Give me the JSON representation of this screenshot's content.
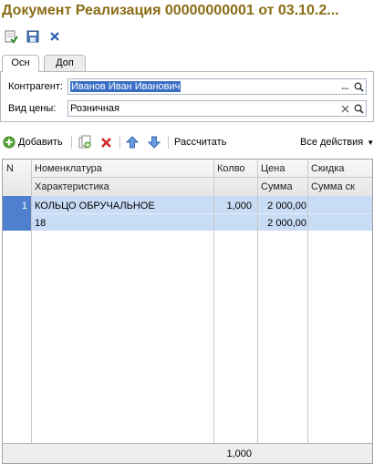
{
  "window": {
    "title": "Документ Реализация 00000000001 от 03.10.2..."
  },
  "toolbar": {
    "items": [
      {
        "name": "post-and-close",
        "icon": "post-and-close-icon"
      },
      {
        "name": "save",
        "icon": "save-icon"
      },
      {
        "name": "close",
        "icon": "close-icon"
      }
    ]
  },
  "tabs": [
    {
      "label": "Осн",
      "active": true
    },
    {
      "label": "Доп",
      "active": false
    }
  ],
  "form": {
    "counterparty_label": "Контрагент:",
    "counterparty_value": "Иванов Иван Иванович",
    "counterparty_buttons": [
      "...",
      "search-icon"
    ],
    "price_type_label": "Вид цены:",
    "price_type_value": "Розничная",
    "price_type_buttons": [
      "clear-icon",
      "search-icon"
    ]
  },
  "command_bar": {
    "add_label": "Добавить",
    "recalculate_label": "Рассчитать",
    "all_actions_label": "Все действия"
  },
  "table": {
    "headers_row1": [
      "N",
      "Номенклатура",
      "Колво",
      "Цена",
      "Скидка"
    ],
    "headers_row2": [
      "",
      "Характеристика",
      "",
      "Сумма",
      "Сумма ск"
    ],
    "rows": [
      {
        "n": "1",
        "item": "КОЛЬЦО ОБРУЧАЛЬНОЕ",
        "characteristic": "18",
        "qty": "1,000",
        "price": "2 000,00",
        "sum": "2 000,00",
        "discount": "",
        "discount_sum": ""
      }
    ],
    "footer_qty": "1,000"
  },
  "colors": {
    "title": "#8a6d16",
    "row_selected": "#c9dcf5",
    "selection": "#3a6fc6"
  }
}
